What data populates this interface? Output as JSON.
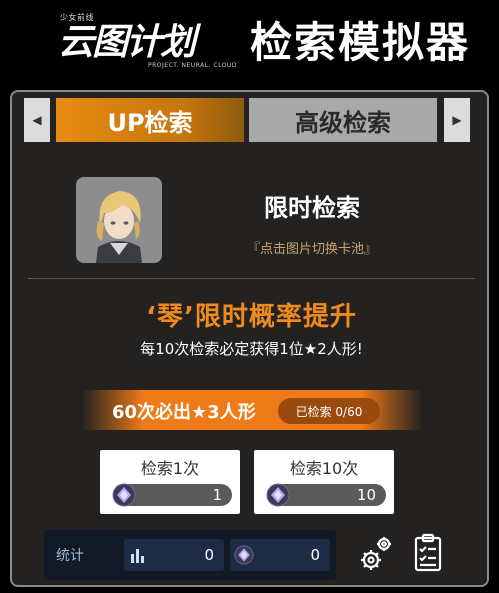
{
  "header": {
    "logo_small": "少女前线",
    "logo_main": "云图计划",
    "logo_sub": "PROJECT. NEURAL. CLOUD",
    "title": "检索模拟器"
  },
  "tabs": [
    {
      "label": "UP检索",
      "active": true
    },
    {
      "label": "高级检索",
      "active": false
    }
  ],
  "pool": {
    "title": "限时检索",
    "hint": "『点击图片切换卡池』",
    "rate_up": "‘琴’限时概率提升",
    "guarantee": "每10次检索必定获得1位★2人形!"
  },
  "pity": {
    "text": "60次必出★3人形",
    "count": "已检索 0/60"
  },
  "pulls": {
    "one": {
      "label": "检索1次",
      "cost": "1"
    },
    "ten": {
      "label": "检索10次",
      "cost": "10"
    }
  },
  "stats": {
    "label": "统计",
    "count_a": "0",
    "count_b": "0"
  },
  "icons": {
    "tab_left": "chevron-left-icon",
    "tab_right": "chevron-right-icon",
    "gem": "gem-icon",
    "bar_chart": "bar-chart-icon",
    "settings": "gear-icon",
    "log": "checklist-icon"
  },
  "colors": {
    "accent_orange": "#ee7a18",
    "panel_bg": "#232220",
    "stats_bg": "#121a26"
  }
}
